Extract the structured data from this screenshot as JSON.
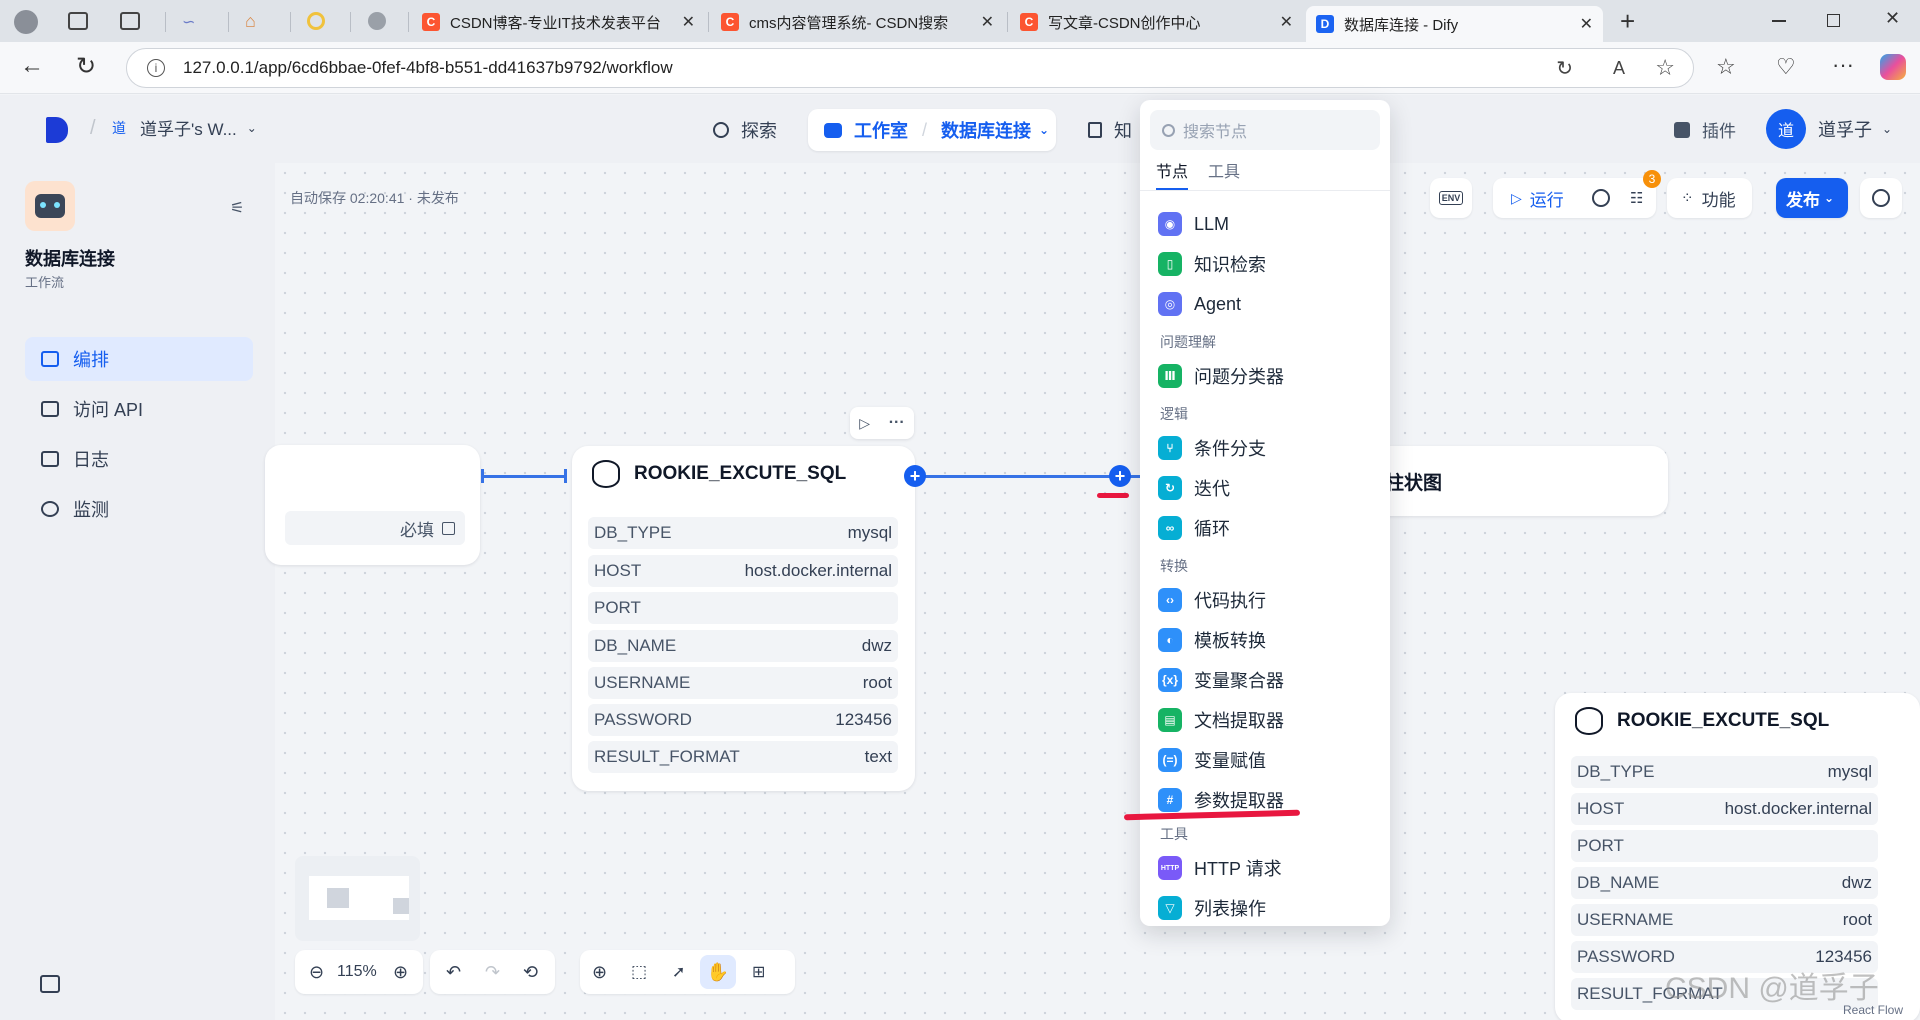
{
  "browser": {
    "tabs": [
      {
        "title": "CSDN博客-专业IT技术发表平台",
        "icon": "csdn-icon",
        "color": "#fc5531"
      },
      {
        "title": "cms内容管理系统- CSDN搜索",
        "icon": "csdn-icon",
        "color": "#fc5531"
      },
      {
        "title": "写文章-CSDN创作中心",
        "icon": "csdn-icon",
        "color": "#fc5531"
      },
      {
        "title": "数据库连接 - Dify",
        "icon": "dify-icon",
        "color": "#1c64f2"
      }
    ],
    "url": "127.0.0.1/app/6cd6bbae-0fef-4bf8-b551-dd41637b9792/workflow",
    "new_tab": "+"
  },
  "topnav": {
    "workspace_avatar": "道",
    "workspace_name": "道孚子's W...",
    "explore": "探索",
    "studio": "工作室",
    "app_name": "数据库连接",
    "knowledge": "知",
    "plugins": "插件",
    "user_avatar": "道",
    "user_name": "道孚子"
  },
  "sidebar": {
    "app_title": "数据库连接",
    "app_type": "工作流",
    "items": [
      {
        "label": "编排",
        "icon": "layout-icon",
        "active": true
      },
      {
        "label": "访问 API",
        "icon": "terminal-icon"
      },
      {
        "label": "日志",
        "icon": "log-icon"
      },
      {
        "label": "监测",
        "icon": "monitor-icon"
      }
    ]
  },
  "toolbar": {
    "autosave": "自动保存 02:20:41 · 未发布",
    "env": "ENV",
    "run": "运行",
    "badge": "3",
    "features": "功能",
    "publish": "发布"
  },
  "left_node": {
    "required": "必填"
  },
  "node": {
    "title": "ROOKIE_EXCUTE_SQL",
    "params": [
      {
        "name": "DB_TYPE",
        "value": "mysql"
      },
      {
        "name": "HOST",
        "value": "host.docker.internal"
      },
      {
        "name": "PORT",
        "value": ""
      },
      {
        "name": "DB_NAME",
        "value": "dwz"
      },
      {
        "name": "USERNAME",
        "value": "root"
      },
      {
        "name": "PASSWORD",
        "value": "123456"
      },
      {
        "name": "RESULT_FORMAT",
        "value": "text"
      }
    ]
  },
  "right_node": {
    "title_fragment": "柱状图"
  },
  "popup": {
    "search_placeholder": "搜索节点",
    "tabs": [
      "节点",
      "工具"
    ],
    "items": [
      {
        "label": "LLM",
        "color": "#6172f3",
        "icon": "llm-icon"
      },
      {
        "label": "知识检索",
        "color": "#16b364",
        "icon": "knowledge-icon"
      },
      {
        "label": "Agent",
        "color": "#6172f3",
        "icon": "agent-icon"
      },
      {
        "group": "问题理解"
      },
      {
        "label": "问题分类器",
        "color": "#16b364",
        "icon": "classifier-icon"
      },
      {
        "group": "逻辑"
      },
      {
        "label": "条件分支",
        "color": "#06aed4",
        "icon": "branch-icon"
      },
      {
        "label": "迭代",
        "color": "#06aed4",
        "icon": "iteration-icon"
      },
      {
        "label": "循环",
        "color": "#06aed4",
        "icon": "loop-icon"
      },
      {
        "group": "转换"
      },
      {
        "label": "代码执行",
        "color": "#2e90fa",
        "icon": "code-icon"
      },
      {
        "label": "模板转换",
        "color": "#2e90fa",
        "icon": "template-icon"
      },
      {
        "label": "变量聚合器",
        "color": "#2e90fa",
        "icon": "aggregator-icon"
      },
      {
        "label": "文档提取器",
        "color": "#16b364",
        "icon": "doc-extractor-icon"
      },
      {
        "label": "变量赋值",
        "color": "#2e90fa",
        "icon": "assigner-icon"
      },
      {
        "label": "参数提取器",
        "color": "#2e90fa",
        "icon": "param-extractor-icon"
      },
      {
        "group": "工具"
      },
      {
        "label": "HTTP 请求",
        "color": "#7a5af8",
        "icon": "http-icon"
      },
      {
        "label": "列表操作",
        "color": "#06aed4",
        "icon": "list-icon"
      }
    ]
  },
  "bottom_controls": {
    "zoom": "115%"
  },
  "watermark": "CSDN @道孚子",
  "react_flow": "React Flow"
}
